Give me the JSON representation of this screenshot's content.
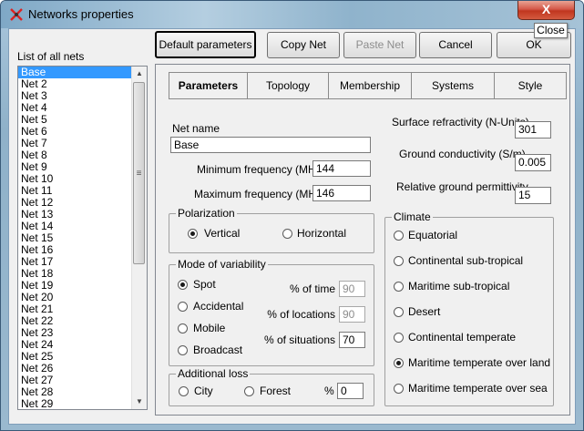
{
  "window": {
    "title": "Networks properties",
    "close_glyph": "X",
    "close_tooltip": "Close"
  },
  "toolbar": {
    "default_params": "Default parameters",
    "copy_net": "Copy Net",
    "paste_net": "Paste Net",
    "cancel": "Cancel",
    "ok": "OK"
  },
  "list": {
    "title": "List of all nets",
    "items": [
      "Base",
      "Net  2",
      "Net  3",
      "Net  4",
      "Net  5",
      "Net  6",
      "Net  7",
      "Net  8",
      "Net  9",
      "Net 10",
      "Net 11",
      "Net 12",
      "Net 13",
      "Net 14",
      "Net 15",
      "Net 16",
      "Net 17",
      "Net 18",
      "Net 19",
      "Net 20",
      "Net 21",
      "Net 22",
      "Net 23",
      "Net 24",
      "Net 25",
      "Net 26",
      "Net 27",
      "Net 28",
      "Net 29"
    ],
    "selected_index": 0
  },
  "tabs": [
    "Parameters",
    "Topology",
    "Membership",
    "Systems",
    "Style"
  ],
  "active_tab": "Parameters",
  "params": {
    "net_name_label": "Net name",
    "net_name": "Base",
    "min_freq_label": "Minimum frequency (MHz)",
    "min_freq": "144",
    "max_freq_label": "Maximum frequency (MHz)",
    "max_freq": "146",
    "surface_refr_label": "Surface refractivity (N-Units)",
    "surface_refr": "301",
    "ground_cond_label": "Ground conductivity (S/m)",
    "ground_cond": "0.005",
    "rel_perm_label": "Relative ground permittivity",
    "rel_perm": "15"
  },
  "polarization": {
    "title": "Polarization",
    "vertical": "Vertical",
    "horizontal": "Horizontal",
    "selected": "Vertical"
  },
  "variability": {
    "title": "Mode of variability",
    "options": [
      "Spot",
      "Accidental",
      "Mobile",
      "Broadcast"
    ],
    "selected": "Spot",
    "time_label": "% of time",
    "time": "90",
    "locations_label": "% of locations",
    "locations": "90",
    "situations_label": "% of situations",
    "situations": "70"
  },
  "additional_loss": {
    "title": "Additional loss",
    "city": "City",
    "forest": "Forest",
    "percent_label": "%",
    "percent": "0"
  },
  "climate": {
    "title": "Climate",
    "options": [
      "Equatorial",
      "Continental sub-tropical",
      "Maritime sub-tropical",
      "Desert",
      "Continental temperate",
      "Maritime temperate over land",
      "Maritime temperate over sea"
    ],
    "selected": "Maritime temperate over land"
  }
}
